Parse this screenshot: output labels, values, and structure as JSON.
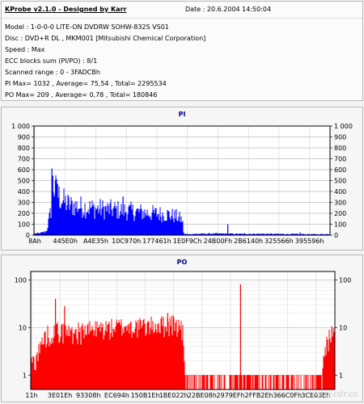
{
  "header": {
    "app_title": "KProbe v2.1.0 - Designed by Karr",
    "date": "Date : 20.6.2004 14:50:04",
    "model": "Model : 1-0-0-0 LITE-ON DVDRW SOHW-832S  VS01",
    "disc": "Disc : DVD+R DL , MKM001 [Mitsubishi Chemical Corporation]",
    "speed": "Speed : Max",
    "ecc": "ECC blocks sum (PI/PO) : 8/1",
    "range": "Scanned range : 0 - 3FADCBh",
    "pi_stats": "PI Max= 1032 , Average= 75,54 , Total= 2295534",
    "po_stats": "PO Max= 209 , Average= 0,78 , Total= 180846"
  },
  "watermark": "www.cdr.cz",
  "chart_data": [
    {
      "type": "bar",
      "title": "PI",
      "color": "#0000ff",
      "y_scale": "linear",
      "ylim": [
        0,
        1000
      ],
      "y_ticks": [
        "0",
        "100",
        "200",
        "300",
        "400",
        "500",
        "600",
        "700",
        "800",
        "900",
        "1 000"
      ],
      "x_tick_labels": [
        "8Ah",
        "445E0h",
        "A4E35h",
        "10C970h",
        "177461h",
        "1E0F9Ch",
        "24B00Fh",
        "2B6140h",
        "325566h",
        "395596h"
      ],
      "grid": true,
      "profile_x": [
        0,
        0.02,
        0.04,
        0.055,
        0.06,
        0.07,
        0.08,
        0.1,
        0.12,
        0.15,
        0.2,
        0.25,
        0.3,
        0.35,
        0.4,
        0.45,
        0.48,
        0.5,
        0.505,
        0.55,
        0.6,
        0.65,
        0.7,
        0.75,
        0.8,
        0.85,
        0.9,
        0.95,
        1.0
      ],
      "profile_y": [
        15,
        20,
        40,
        250,
        490,
        450,
        390,
        330,
        295,
        285,
        265,
        255,
        245,
        230,
        215,
        205,
        185,
        150,
        10,
        12,
        15,
        14,
        12,
        13,
        12,
        11,
        10,
        9,
        10
      ],
      "spikes": [
        {
          "x": 0.059,
          "y": 610
        },
        {
          "x": 0.062,
          "y": 545
        },
        {
          "x": 0.071,
          "y": 500
        },
        {
          "x": 0.078,
          "y": 470
        },
        {
          "x": 0.3,
          "y": 355
        },
        {
          "x": 0.655,
          "y": 100
        },
        {
          "x": 0.9,
          "y": 25
        }
      ]
    },
    {
      "type": "bar",
      "title": "PO",
      "color": "#ff0000",
      "y_scale": "log",
      "ylim": [
        0.5,
        150
      ],
      "y_ticks": [
        "1",
        "10",
        "100"
      ],
      "x_tick_labels": [
        "11h",
        "3E01Eh",
        "93308h",
        "EC694h",
        "150B1Eh",
        "1BE022h",
        "22BE08h",
        "2979EFh",
        "2FFB2Eh",
        "366C0Fh",
        "3CE03Eh"
      ],
      "grid": true,
      "profile_x": [
        0,
        0.02,
        0.05,
        0.08,
        0.12,
        0.18,
        0.24,
        0.3,
        0.36,
        0.42,
        0.46,
        0.49,
        0.5,
        0.505,
        0.6,
        0.7,
        0.8,
        0.9,
        0.96,
        0.985,
        1.0
      ],
      "profile_y": [
        2,
        3,
        8,
        10,
        9,
        10,
        11,
        12,
        12,
        13,
        14,
        12,
        8,
        1,
        1,
        1,
        1,
        1,
        1.5,
        8,
        10
      ],
      "spikes": [
        {
          "x": 0.08,
          "y": 40
        },
        {
          "x": 0.11,
          "y": 28
        },
        {
          "x": 0.45,
          "y": 20
        },
        {
          "x": 0.468,
          "y": 18
        },
        {
          "x": 0.69,
          "y": 80
        }
      ]
    }
  ]
}
